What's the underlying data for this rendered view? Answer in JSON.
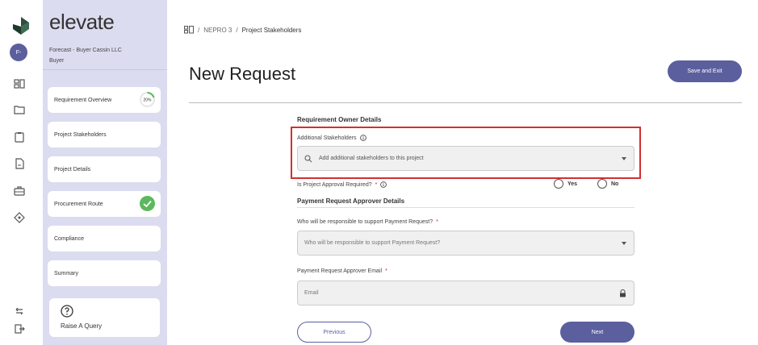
{
  "sidebar": {
    "brand": "elevate",
    "avatar_initials": "F-",
    "org_line1": "Forecast - Buyer Cassin LLC",
    "org_line2": "Buyer",
    "steps": [
      {
        "label": "Requirement Overview",
        "badge": "20%"
      },
      {
        "label": "Project Stakeholders"
      },
      {
        "label": "Project Details"
      },
      {
        "label": "Procurement Route",
        "badge": "check"
      },
      {
        "label": "Compliance"
      },
      {
        "label": "Summary"
      }
    ],
    "query_label": "Raise A Query"
  },
  "breadcrumb": {
    "project": "NEPRO 3",
    "current": "Project Stakeholders"
  },
  "page": {
    "title": "New Request",
    "save_label": "Save and Exit"
  },
  "form": {
    "section1": "Requirement Owner Details",
    "stakeholders_label": "Additional Stakeholders",
    "stakeholders_placeholder": "Add additional stakeholders to this project",
    "approval_label": "Is Project Approval Required?",
    "required_mark": "*",
    "yes": "Yes",
    "no": "No",
    "section2": "Payment Request Approver Details",
    "responsible_label": "Who will be responsible to support Payment Request?",
    "responsible_placeholder": "Who will be responsible to support Payment Request?",
    "email_label": "Payment Request Approver Email",
    "email_placeholder": "Email",
    "previous": "Previous",
    "next": "Next"
  },
  "colors": {
    "accent": "#5b5f9e",
    "sidebar_bg": "#dcdcf0",
    "highlight": "#d32f2f",
    "success": "#5cb85c"
  }
}
